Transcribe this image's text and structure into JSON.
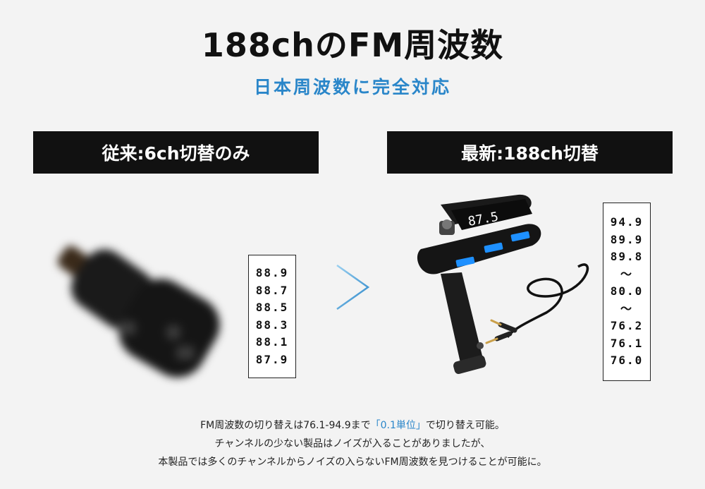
{
  "header": {
    "title": "188chのFM周波数",
    "subtitle": "日本周波数に完全対応"
  },
  "comparison": {
    "old_label": "従来:6ch切替のみ",
    "new_label": "最新:188ch切替",
    "old_frequencies": [
      "88.9",
      "88.7",
      "88.5",
      "88.3",
      "88.1",
      "87.9"
    ],
    "new_frequencies": [
      "94.9",
      "89.9",
      "89.8",
      "～",
      "80.0",
      "～",
      "76.2",
      "76.1",
      "76.0"
    ],
    "display_reading": "87.5"
  },
  "description": {
    "line1_pre": "FM周波数の切り替えは76.1-94.9まで",
    "line1_highlight": "「0.1単位」",
    "line1_post": "で切り替え可能。",
    "line2": "チャンネルの少ない製品はノイズが入ることがありましたが、",
    "line3": "本製品では多くのチャンネルからノイズの入らないFM周波数を見つけることが可能に。"
  },
  "colors": {
    "accent": "#2a86c9",
    "label_bg": "#111111",
    "background": "#f3f3f3"
  },
  "icons": {
    "arrow": "chevron-right-icon"
  }
}
